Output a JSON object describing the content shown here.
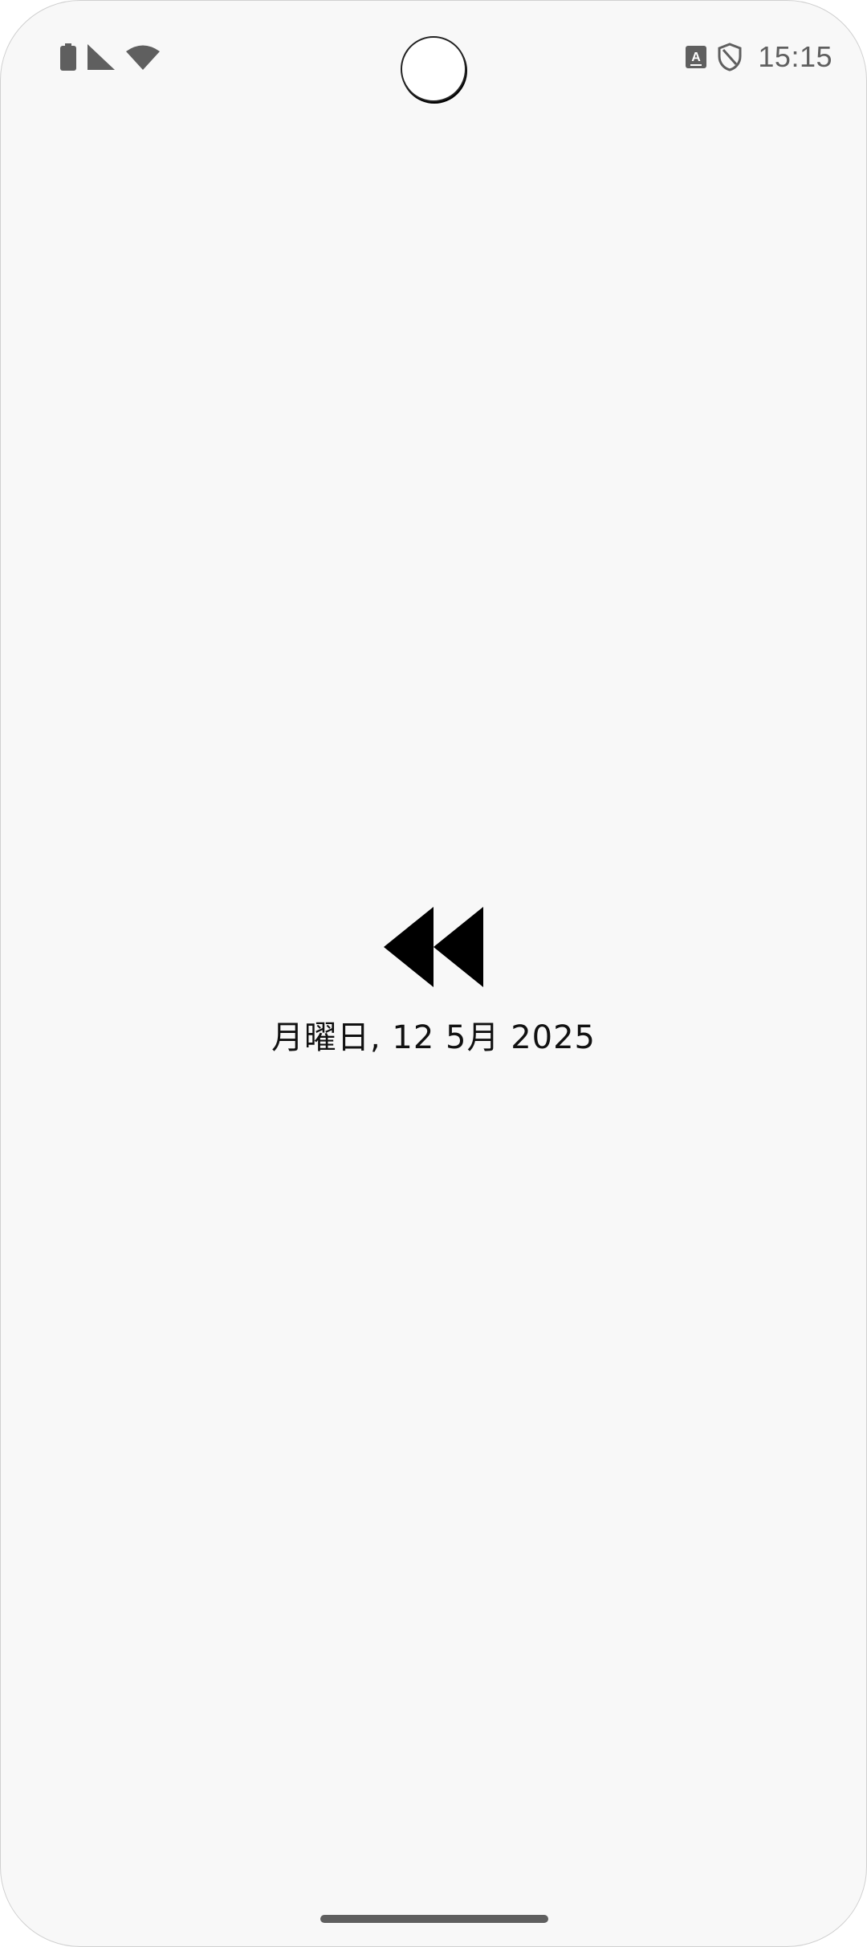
{
  "status_bar": {
    "time": "15:15",
    "left_icons": [
      "battery-icon",
      "signal-icon",
      "wifi-icon"
    ],
    "right_icons": [
      "keyboard-a-icon",
      "shield-icon"
    ],
    "icon_color": "#5f5f5f"
  },
  "main": {
    "icon": "rewind-icon",
    "date": "月曜日, 12 5月 2025"
  },
  "colors": {
    "background": "#f8f8f8",
    "text": "#111111",
    "icon": "#000000"
  }
}
